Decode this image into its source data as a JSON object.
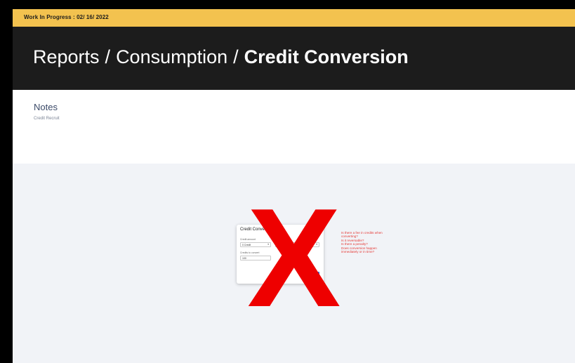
{
  "banner": {
    "text": "Work In Progress : 02/ 16/ 2022"
  },
  "breadcrumb": {
    "items": [
      "Reports",
      "Consumption"
    ],
    "separator": "/",
    "current": "Credit Conversion"
  },
  "notes": {
    "title": "Notes",
    "text": "Credit Recruit"
  },
  "dialog": {
    "title": "Credit Conversion",
    "field1_label": "Credit amount",
    "field1_value": "0 Credit",
    "field2_value": "20",
    "field3_label": "Credits to convert",
    "field3_value": "100"
  },
  "overlay": {
    "mark": "X",
    "color": "#ee0000"
  },
  "annotations": [
    "Is there a fee in credits when",
    "converting?",
    "Is it reversable?",
    "Is there a penalty?",
    "Does conversion happen",
    "immediately or in time?"
  ],
  "colors": {
    "banner": "#f3c24f",
    "header": "#1c1c1c",
    "annotation": "#e53935"
  }
}
